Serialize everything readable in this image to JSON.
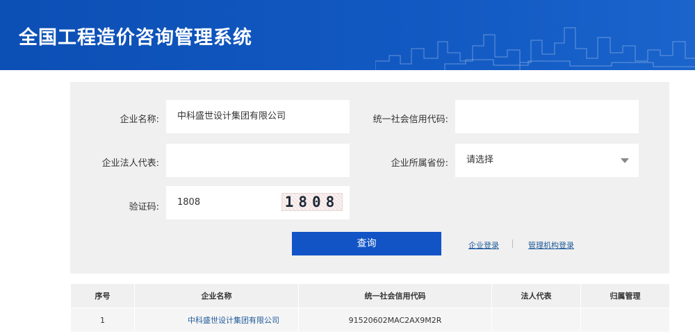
{
  "header": {
    "title": "全国工程造价咨询管理系统",
    "bg_color": "#1259c2"
  },
  "form": {
    "company_name": {
      "label": "企业名称:",
      "value": "中科盛世设计集团有限公司"
    },
    "credit_code": {
      "label": "统一社会信用代码:",
      "value": ""
    },
    "legal_rep": {
      "label": "企业法人代表:",
      "value": ""
    },
    "province": {
      "label": "企业所属省份:",
      "value": "请选择"
    },
    "captcha": {
      "label": "验证码:",
      "value": "1808",
      "image_text": "1808"
    }
  },
  "actions": {
    "query_label": "查询",
    "enterprise_login": "企业登录",
    "admin_login": "管理机构登录"
  },
  "table": {
    "headers": [
      "序号",
      "企业名称",
      "统一社会信用代码",
      "法人代表",
      "归属管理"
    ],
    "rows": [
      [
        "1",
        "中科盛世设计集团有限公司",
        "91520602MAC2AX9M2R",
        "",
        ""
      ]
    ]
  },
  "colors": {
    "accent": "#1254c6",
    "link": "#1f5a9a",
    "panel": "#f0f0f0"
  }
}
